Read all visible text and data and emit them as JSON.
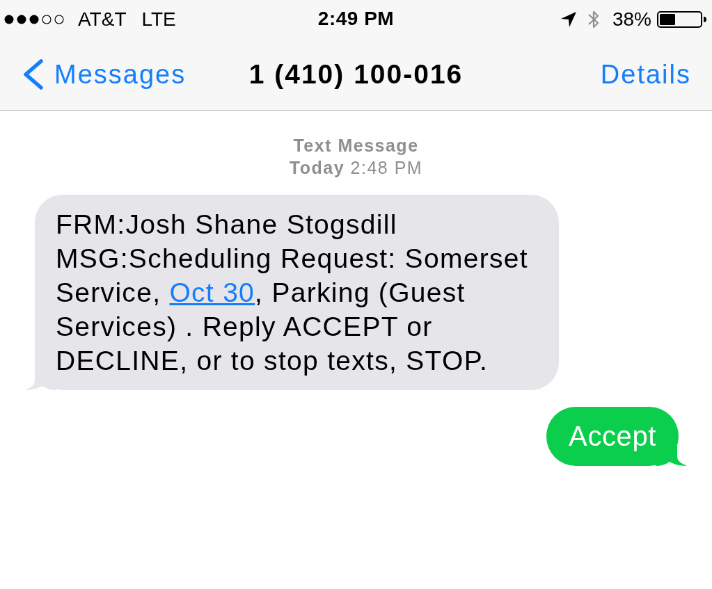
{
  "status_bar": {
    "carrier": "AT&T",
    "network": "LTE",
    "time": "2:49 PM",
    "battery": "38%"
  },
  "nav_bar": {
    "back": "Messages",
    "title": "1 (410) 100-016",
    "action": "Details"
  },
  "thread": {
    "header": {
      "label": "Text Message",
      "time": "**Today** 2:48 PM"
    },
    "messages": [
      {
        "kind": "incoming",
        "parts": [
          {
            "kind": "text",
            "text": "FRM:Josh Shane Stogsdill MSG:Scheduling Request: Somerset Service, "
          },
          {
            "kind": "link",
            "text": "Oct 30"
          },
          {
            "kind": "text",
            "text": ", Parking (Guest Services) . Reply ACCEPT or DECLINE, or to stop texts, STOP."
          }
        ]
      },
      {
        "kind": "outgoing",
        "parts": [
          {
            "kind": "text",
            "text": "Accept"
          }
        ]
      }
    ]
  }
}
